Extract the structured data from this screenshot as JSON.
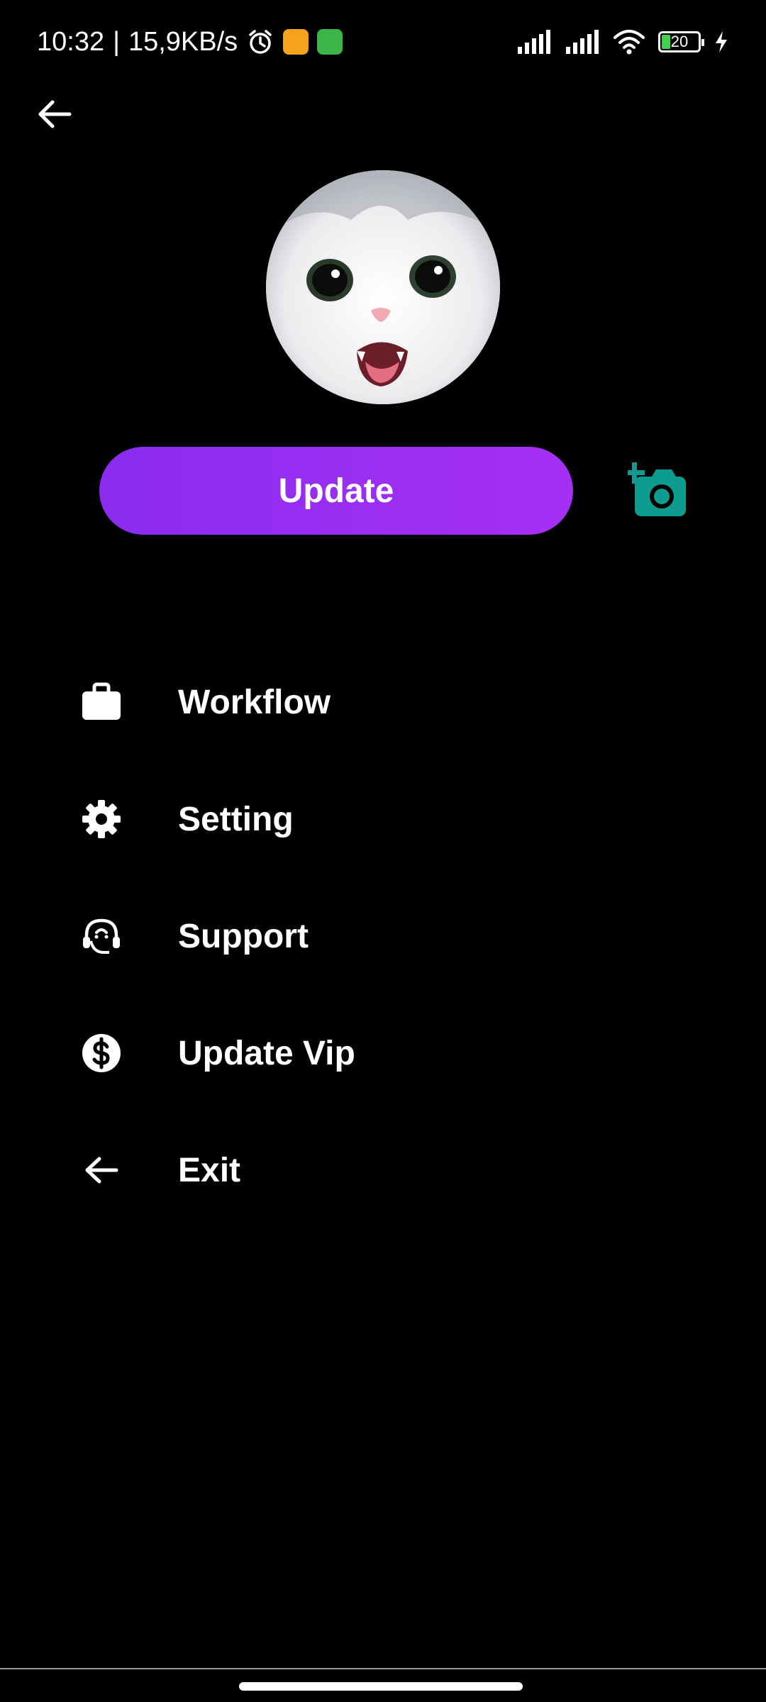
{
  "status_bar": {
    "time": "10:32",
    "separator": "|",
    "network_speed": "15,9KB/s",
    "battery_level": "20",
    "icons": [
      "alarm-icon",
      "notification-orange-icon",
      "notification-green-icon",
      "signal-icon",
      "signal-icon",
      "wifi-icon",
      "battery-icon",
      "charging-icon"
    ]
  },
  "header": {
    "back_icon": "back-arrow-icon"
  },
  "profile": {
    "update_label": "Update",
    "add_photo_icon": "add-photo-icon",
    "accent_button": "#9b2ef4",
    "accent_camera": "#0e9c90"
  },
  "menu": {
    "items": [
      {
        "label": "Workflow",
        "icon": "briefcase-icon"
      },
      {
        "label": "Setting",
        "icon": "gear-icon"
      },
      {
        "label": "Support",
        "icon": "headset-icon"
      },
      {
        "label": "Update Vip",
        "icon": "dollar-icon"
      },
      {
        "label": "Exit",
        "icon": "exit-arrow-icon"
      }
    ]
  }
}
